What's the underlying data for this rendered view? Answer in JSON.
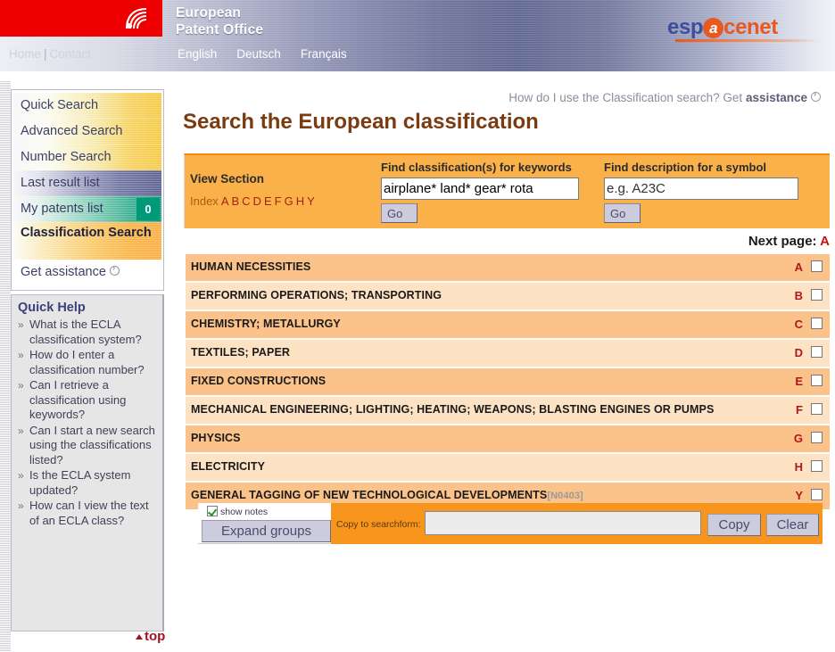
{
  "header": {
    "logo_icon": "epo-swirl-icon",
    "org_line1": "European",
    "org_line2": "Patent Office",
    "brand_esp": "esp",
    "brand_at": "a",
    "brand_cenet": "cenet",
    "nav_home": "Home",
    "nav_separator": "|",
    "nav_contact": "Contact",
    "languages": [
      "English",
      "Deutsch",
      "Français"
    ],
    "accent_red": "#ee0000",
    "brand_blue": "#3c4f9e",
    "brand_orange": "#e8591f"
  },
  "sidebar": {
    "items": [
      {
        "label": "Quick Search",
        "style": "gold",
        "badge": null
      },
      {
        "label": "Advanced Search",
        "style": "gold",
        "badge": null
      },
      {
        "label": "Number Search",
        "style": "gold",
        "badge": null
      },
      {
        "label": "Last result list",
        "style": "purple",
        "badge": null
      },
      {
        "label": "My patents list",
        "style": "teal",
        "badge": "0"
      },
      {
        "label": "Classification Search",
        "style": "orange",
        "badge": null
      },
      {
        "label": "Get assistance",
        "style": "plain",
        "badge": null
      }
    ]
  },
  "quick_help": {
    "title": "Quick Help",
    "bullet": "»",
    "items": [
      "What is the ECLA classification system?",
      "How do I enter a classification number?",
      "Can I retrieve a classification using keywords?",
      "Can I start a new search using the classifications listed?",
      "Is the ECLA system updated?",
      "How can I view the text of an ECLA class?"
    ]
  },
  "top_link": {
    "label": "top"
  },
  "main": {
    "assistance_text": "How do I use the Classification search? Get",
    "assistance_strong": "assistance",
    "page_title": "Search the European classification",
    "next_page_label": "Next page:",
    "next_page_value": "A"
  },
  "search_panel": {
    "view_section_label": "View Section",
    "index_label": "Index",
    "index_letters": [
      "A",
      "B",
      "C",
      "D",
      "E",
      "F",
      "G",
      "H",
      "Y"
    ],
    "keyword_label": "Find classification(s) for keywords",
    "keyword_value": "airplane* land* gear* rota",
    "keyword_go": "Go",
    "symbol_label": "Find description for a symbol",
    "symbol_value": "e.g. A23C",
    "symbol_go": "Go",
    "panel_color": "#fbb14a"
  },
  "classification_rows": [
    {
      "title": "HUMAN NECESSITIES",
      "note": "",
      "letter": "A",
      "checked": false
    },
    {
      "title": "PERFORMING OPERATIONS; TRANSPORTING",
      "note": "",
      "letter": "B",
      "checked": false
    },
    {
      "title": "CHEMISTRY; METALLURGY",
      "note": "",
      "letter": "C",
      "checked": false
    },
    {
      "title": "TEXTILES; PAPER",
      "note": "",
      "letter": "D",
      "checked": false
    },
    {
      "title": "FIXED CONSTRUCTIONS",
      "note": "",
      "letter": "E",
      "checked": false
    },
    {
      "title": "MECHANICAL ENGINEERING; LIGHTING; HEATING; WEAPONS; BLASTING ENGINES OR PUMPS",
      "note": "",
      "letter": "F",
      "checked": false
    },
    {
      "title": "PHYSICS",
      "note": "",
      "letter": "G",
      "checked": false
    },
    {
      "title": "ELECTRICITY",
      "note": "",
      "letter": "H",
      "checked": false
    },
    {
      "title": "GENERAL TAGGING OF NEW TECHNOLOGICAL DEVELOPMENTS",
      "note": "[N0403]",
      "letter": "Y",
      "checked": false
    }
  ],
  "bottom_bar": {
    "show_notes_label": "show notes",
    "show_notes_checked": true,
    "expand_groups_label": "Expand groups",
    "copy_to_searchform_label": "Copy to searchform:",
    "copy_field_value": "",
    "copy_button": "Copy",
    "clear_button": "Clear"
  }
}
